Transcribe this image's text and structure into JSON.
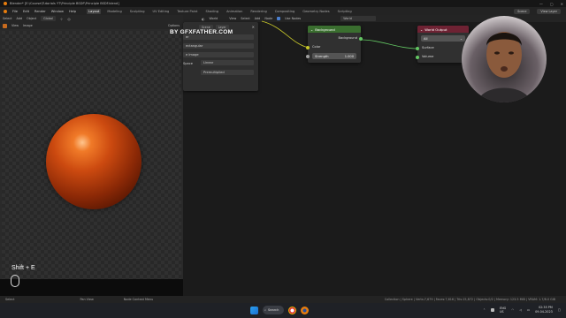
{
  "titlebar": {
    "title": "Blender* [E:\\Course\\Tutorials YT\\Principle BSDF\\Principle BSDF.blend]",
    "win_buttons": [
      "—",
      "▢",
      "✕"
    ]
  },
  "menubar": {
    "items": [
      "File",
      "Edit",
      "Render",
      "Window",
      "Help"
    ],
    "workspaces": [
      "Layout",
      "Modeling",
      "Sculpting",
      "UV Editing",
      "Texture Paint",
      "Shading",
      "Animation",
      "Rendering",
      "Compositing",
      "Geometry Nodes",
      "Scripting"
    ],
    "active_workspace": "Layout",
    "scene": "Scene",
    "view_layer": "View Layer"
  },
  "left_header": {
    "items": [
      "Select",
      "Add",
      "Object"
    ],
    "dropdown": "Global"
  },
  "image_header": {
    "items": [
      "View",
      "Image"
    ],
    "options": "Options"
  },
  "node_header": {
    "world_label": "World",
    "items": [
      "View",
      "Select",
      "Add",
      "Node"
    ],
    "use_nodes": "Use Nodes",
    "world_name": "World"
  },
  "panel": {
    "tabs": [
      "Scene",
      "Layer"
    ],
    "rows": [
      "Full",
      "Rectangular",
      "Single Image",
      "Linear",
      "Premultiplied"
    ],
    "fragments": [
      "er",
      "ectangular",
      "e Image",
      "Space",
      "Linear",
      "Premultiplied"
    ]
  },
  "watermark": "BY GFXFATHER.COM",
  "background_node": {
    "title": "Background",
    "output": "Background",
    "color_label": "Color",
    "strength_label": "Strength",
    "strength_value": "1.000"
  },
  "world_output_node": {
    "title": "World Output",
    "target": "All",
    "surface": "Surface",
    "volume": "Volume"
  },
  "overlay": {
    "shortcut": "Shift + E"
  },
  "statusbar": {
    "left": [
      "Select",
      "Pan View",
      "Node Context Menu"
    ],
    "right": "Collection | Sphere | Verts:7,679 | Faces:7,616 | Tris:15,872 | Objects:0/2 | Memory: 123.5 MiB | VRAM: 1.7/8.0 GiB"
  },
  "taskbar": {
    "search": "Search",
    "lang": "ENG",
    "region": "US",
    "time": "02:35 PM",
    "date": "09-04-2023"
  },
  "colors": {
    "background_header": "#3a6e2f",
    "world_output_header": "#6e2233",
    "socket_yellow": "#c7c729",
    "socket_green": "#63c763"
  }
}
